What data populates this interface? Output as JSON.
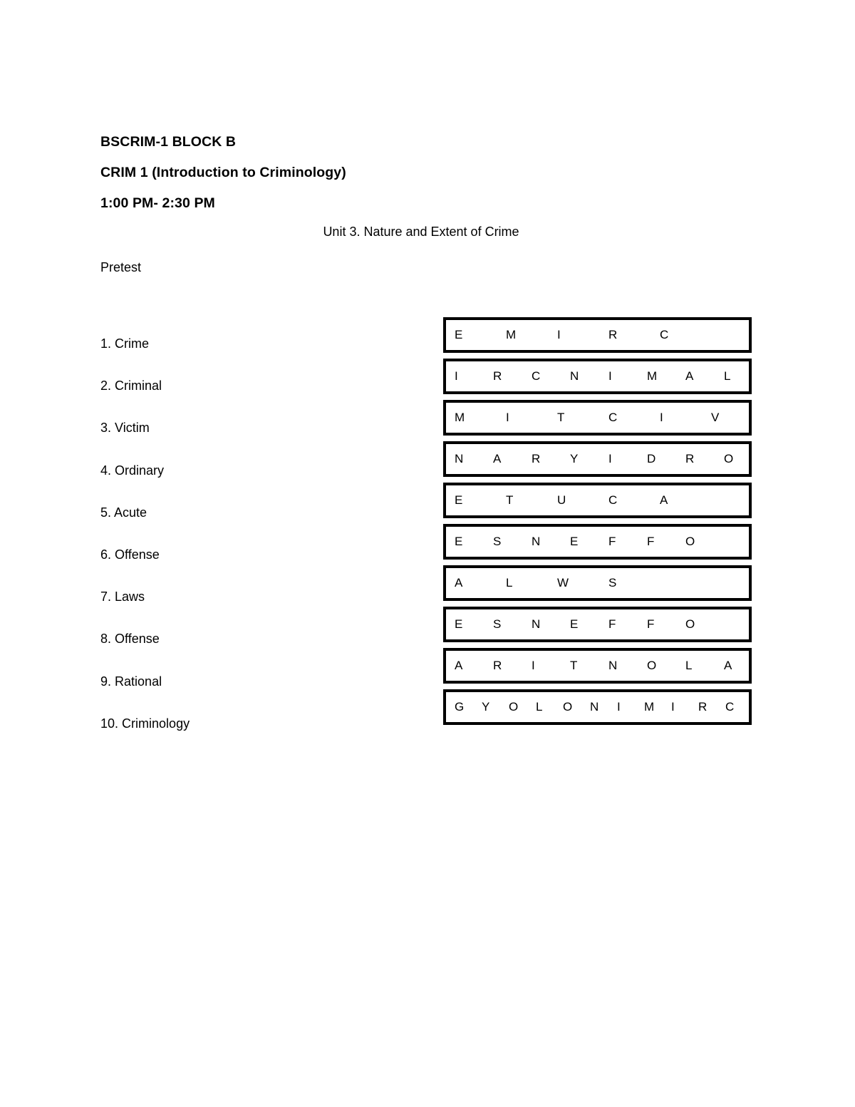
{
  "document": {
    "header_lines": [
      "BSCRIM-1 BLOCK B",
      "CRIM 1 (Introduction to Criminology)",
      "1:00 PM- 2:30 PM"
    ],
    "unit_title": "Unit 3. Nature and Extent of Crime",
    "section_label": "Pretest",
    "word_list": [
      {
        "number": "1.",
        "word": "Crime"
      },
      {
        "number": "2.",
        "word": "Criminal"
      },
      {
        "number": "3.",
        "word": "Victim"
      },
      {
        "number": "4.",
        "word": "Ordinary"
      },
      {
        "number": "5.",
        "word": "Acute"
      },
      {
        "number": "6.",
        "word": "Offense"
      },
      {
        "number": "7.",
        "word": "Laws"
      },
      {
        "number": "8.",
        "word": "Offense"
      },
      {
        "number": "9.",
        "word": "Rational"
      },
      {
        "number": "10.",
        "word": "Criminology"
      }
    ],
    "scrambled_rows": [
      {
        "letters": [
          "E",
          "M",
          "I",
          "R",
          "C"
        ],
        "pitch": 72
      },
      {
        "letters": [
          "I",
          "R",
          "C",
          "N",
          "I",
          "M",
          "A",
          "L"
        ],
        "pitch": 54
      },
      {
        "letters": [
          "M",
          "I",
          "T",
          "C",
          "I",
          "V"
        ],
        "pitch": 72
      },
      {
        "letters": [
          "N",
          "A",
          "R",
          "Y",
          "I",
          "D",
          "R",
          "O"
        ],
        "pitch": 54
      },
      {
        "letters": [
          "E",
          "T",
          "U",
          "C",
          "A"
        ],
        "pitch": 72
      },
      {
        "letters": [
          "E",
          "S",
          "N",
          "E",
          "F",
          "F",
          "O"
        ],
        "pitch": 54
      },
      {
        "letters": [
          "A",
          "L",
          "W",
          "S"
        ],
        "pitch": 72
      },
      {
        "letters": [
          "E",
          "S",
          "N",
          "E",
          "F",
          "F",
          "O"
        ],
        "pitch": 54
      },
      {
        "letters": [
          "A",
          "R",
          "I",
          "T",
          "N",
          "O",
          "L",
          "A"
        ],
        "pitch": 54
      },
      {
        "letters": [
          "G",
          "Y",
          "O",
          "L",
          "O",
          "N",
          "I",
          "M",
          "I",
          "R",
          "C"
        ],
        "pitch": 38
      }
    ]
  },
  "colors": {
    "page_background": "#ffffff",
    "text": "#000000",
    "box_border": "#000000"
  }
}
